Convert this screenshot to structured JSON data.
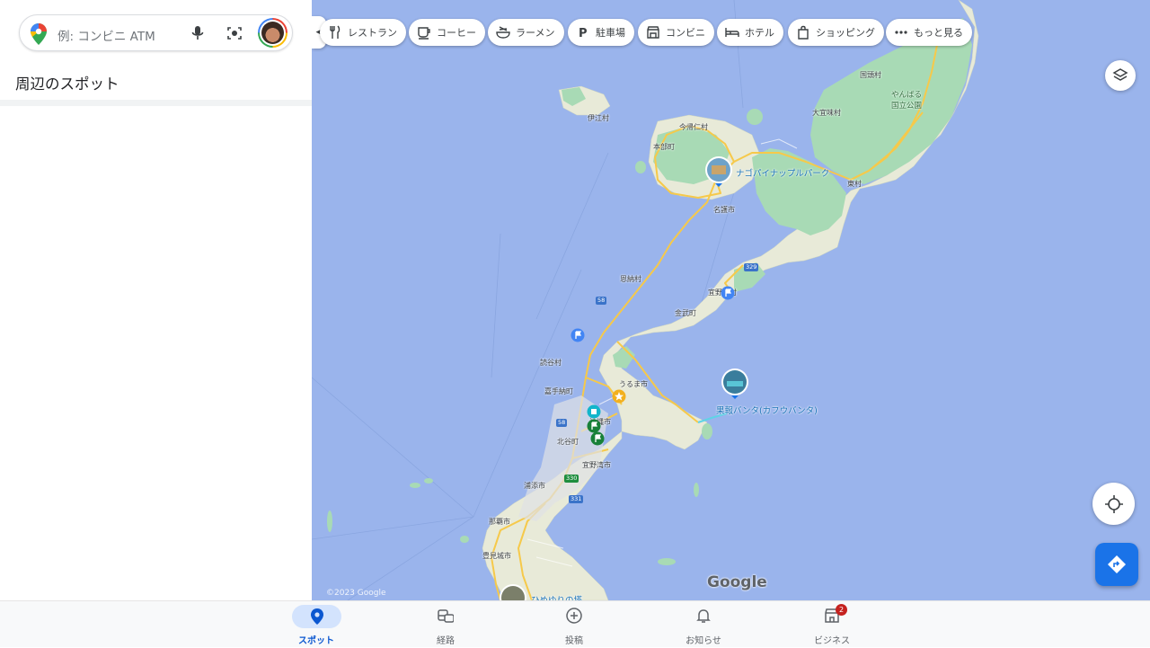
{
  "search": {
    "placeholder": "例: コンビニ ATM"
  },
  "panel": {
    "title": "周辺のスポット"
  },
  "chips": [
    {
      "label": "レストラン",
      "icon": "utensils-icon"
    },
    {
      "label": "コーヒー",
      "icon": "coffee-icon"
    },
    {
      "label": "ラーメン",
      "icon": "ramen-icon"
    },
    {
      "label": "駐車場",
      "icon": "parking-icon"
    },
    {
      "label": "コンビニ",
      "icon": "store-icon"
    },
    {
      "label": "ホテル",
      "icon": "bed-icon"
    },
    {
      "label": "ショッピング",
      "icon": "shopping-bag-icon"
    },
    {
      "label": "もっと見る",
      "icon": "more-dots-icon"
    }
  ],
  "map": {
    "places": [
      {
        "name": "伊江村"
      },
      {
        "name": "今帰仁村"
      },
      {
        "name": "本部町"
      },
      {
        "name": "名護市"
      },
      {
        "name": "国頭村"
      },
      {
        "name": "大宜味村"
      },
      {
        "name": "東村"
      },
      {
        "name": "やんばる\n国立公園"
      },
      {
        "name": "恩納村"
      },
      {
        "name": "宜野座村"
      },
      {
        "name": "金武町"
      },
      {
        "name": "読谷村"
      },
      {
        "name": "嘉手納町"
      },
      {
        "name": "うるま市"
      },
      {
        "name": "沖縄市"
      },
      {
        "name": "北谷町"
      },
      {
        "name": "宜野湾市"
      },
      {
        "name": "浦添市"
      },
      {
        "name": "那覇市"
      },
      {
        "name": "豊見城市"
      }
    ],
    "pois": [
      {
        "name": "ナゴパイナップルパーク"
      },
      {
        "name": "果報バンタ(カフウバンタ)"
      },
      {
        "name": "ひめゆりの塔"
      }
    ],
    "route_badges": [
      "329",
      "58",
      "58",
      "330",
      "331"
    ],
    "attribution": "©2023 Google",
    "logo": "Google",
    "colors": {
      "sea": "#9ab4ec",
      "land": "#e8ead8",
      "park": "#a8dab5",
      "road": "#f6c94a"
    }
  },
  "bottom_nav": [
    {
      "label": "スポット",
      "icon": "location-pin-icon",
      "active": true
    },
    {
      "label": "経路",
      "icon": "commute-icon",
      "active": false
    },
    {
      "label": "投稿",
      "icon": "add-circle-icon",
      "active": false
    },
    {
      "label": "お知らせ",
      "icon": "bell-icon",
      "active": false
    },
    {
      "label": "ビジネス",
      "icon": "store-front-icon",
      "active": false,
      "badge": "2"
    }
  ]
}
